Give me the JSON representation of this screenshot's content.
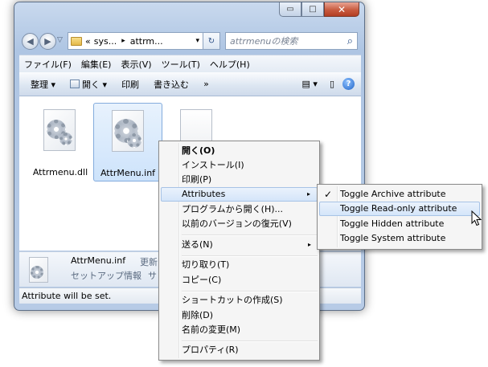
{
  "window": {
    "caption_buttons": {
      "minimize": "▭",
      "maximize": "□",
      "close": "✕"
    }
  },
  "address": {
    "back_icon": "◀",
    "forward_icon": "▶",
    "history_icon": "▽",
    "breadcrumb": [
      "«",
      "sys...",
      "▸",
      "attrm...",
      "▾"
    ],
    "refresh_icon": "↻",
    "search_placeholder": "attrmenuの検索",
    "search_icon": "⌕"
  },
  "menubar": [
    "ファイル(F)",
    "編集(E)",
    "表示(V)",
    "ツール(T)",
    "ヘルプ(H)"
  ],
  "toolbar": {
    "organize": "整理 ▾",
    "open": "開く ▾",
    "print": "印刷",
    "burn": "書き込む",
    "more": "»",
    "view_icon": "▤ ▾",
    "pane_icon": "▯",
    "help_icon": "?"
  },
  "files": [
    {
      "name": "Attrmenu.dll"
    },
    {
      "name": "AttrMenu.inf"
    },
    {
      "name": ""
    }
  ],
  "details": {
    "name": "AttrMenu.inf",
    "modified_label": "更新",
    "type": "セットアップ情報",
    "size_label": "サ"
  },
  "status": "Attribute will be set.",
  "context_menu": {
    "items": [
      "開く(O)",
      "インストール(I)",
      "印刷(P)",
      "Attributes",
      "プログラムから開く(H)...",
      "以前のバージョンの復元(V)",
      "送る(N)",
      "切り取り(T)",
      "コピー(C)",
      "ショートカットの作成(S)",
      "削除(D)",
      "名前の変更(M)",
      "プロパティ(R)"
    ],
    "submenu_arrow": "▸"
  },
  "submenu": {
    "items": [
      "Toggle Archive attribute",
      "Toggle Read-only attribute",
      "Toggle Hidden attribute",
      "Toggle System attribute"
    ],
    "check": "✓"
  }
}
